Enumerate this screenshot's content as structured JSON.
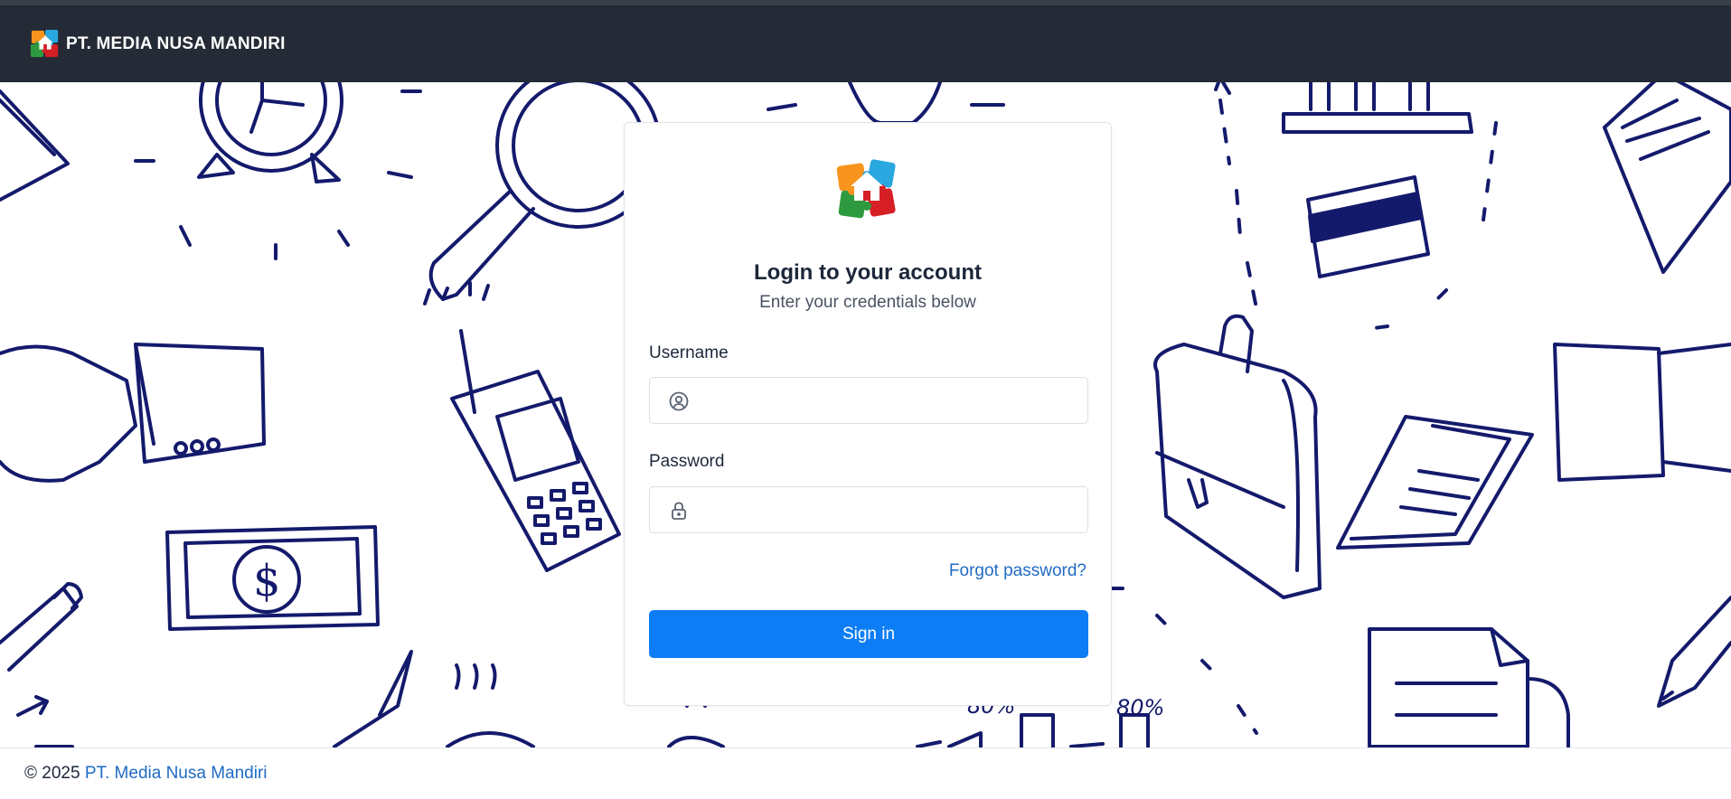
{
  "navbar": {
    "brand_name": "PT. MEDIA NUSA MANDIRI",
    "logo_icon": "puzzle-house-logo"
  },
  "login": {
    "title": "Login to your account",
    "subtitle": "Enter your credentials below",
    "username_label": "Username",
    "username_value": "",
    "username_icon": "user-circle-icon",
    "password_label": "Password",
    "password_value": "",
    "password_icon": "lock-icon",
    "forgot_link": "Forgot password?",
    "signin_button": "Sign in"
  },
  "footer": {
    "copyright": "© 2025",
    "company_link": "PT. Media Nusa Mandiri"
  },
  "colors": {
    "navbar_bg": "#252b36",
    "primary": "#0d7df5",
    "link": "#206bc4",
    "doodle": "#141a6b"
  }
}
